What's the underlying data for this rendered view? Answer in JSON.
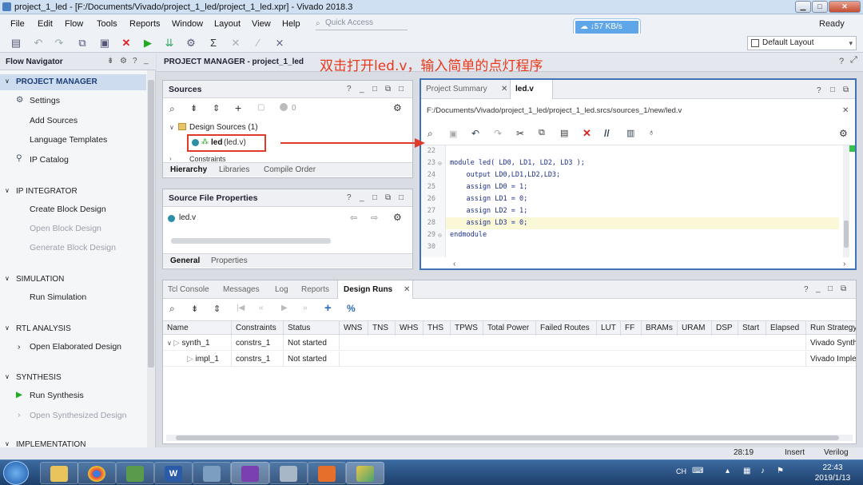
{
  "window": {
    "title": "project_1_led - [F:/Documents/Vivado/project_1_led/project_1_led.xpr] - Vivado 2018.3",
    "status": "Ready"
  },
  "menu": [
    "File",
    "Edit",
    "Flow",
    "Tools",
    "Reports",
    "Window",
    "Layout",
    "View",
    "Help"
  ],
  "quick_access": {
    "placeholder": "Quick Access"
  },
  "net_badge": "↓57 KB/s",
  "layout_select": "Default Layout",
  "flow_navigator": {
    "title": "Flow Navigator",
    "sections": [
      {
        "title": "PROJECT MANAGER",
        "items": [
          "Settings",
          "Add Sources",
          "Language Templates",
          "IP Catalog"
        ]
      },
      {
        "title": "IP INTEGRATOR",
        "items": [
          "Create Block Design",
          "Open Block Design",
          "Generate Block Design"
        ]
      },
      {
        "title": "SIMULATION",
        "items": [
          "Run Simulation"
        ]
      },
      {
        "title": "RTL ANALYSIS",
        "items": [
          "Open Elaborated Design"
        ]
      },
      {
        "title": "SYNTHESIS",
        "items": [
          "Run Synthesis",
          "Open Synthesized Design"
        ]
      },
      {
        "title": "IMPLEMENTATION",
        "items": []
      }
    ]
  },
  "project_manager": {
    "title": "PROJECT MANAGER - project_1_led"
  },
  "annotation": "双击打开led.v，输入简单的点灯程序",
  "sources": {
    "title": "Sources",
    "count_badge": "0",
    "design_sources": "Design Sources (1)",
    "file_name": "led",
    "file_paren": "(led.v)",
    "constraints": "Constraints",
    "tabs": [
      "Hierarchy",
      "Libraries",
      "Compile Order"
    ]
  },
  "source_props": {
    "title": "Source File Properties",
    "file": "led.v",
    "tabs": [
      "General",
      "Properties"
    ]
  },
  "editor": {
    "tabs": [
      "Project Summary",
      "led.v"
    ],
    "path": "F:/Documents/Vivado/project_1_led/project_1_led.srcs/sources_1/new/led.v",
    "lines": [
      {
        "n": "22",
        "text": ""
      },
      {
        "n": "23",
        "text": "module led( LD0, LD1, LD2, LD3 );"
      },
      {
        "n": "24",
        "text": "    output LD0,LD1,LD2,LD3;"
      },
      {
        "n": "25",
        "text": "    assign LD0 = 1;"
      },
      {
        "n": "26",
        "text": "    assign LD1 = 0;"
      },
      {
        "n": "27",
        "text": "    assign LD2 = 1;"
      },
      {
        "n": "28",
        "text": "    assign LD3 = 0;"
      },
      {
        "n": "29",
        "text": "endmodule"
      },
      {
        "n": "30",
        "text": ""
      }
    ]
  },
  "bottom": {
    "tabs": [
      "Tcl Console",
      "Messages",
      "Log",
      "Reports",
      "Design Runs"
    ],
    "columns": [
      "Name",
      "Constraints",
      "Status",
      "WNS",
      "TNS",
      "WHS",
      "THS",
      "TPWS",
      "Total Power",
      "Failed Routes",
      "LUT",
      "FF",
      "BRAMs",
      "URAM",
      "DSP",
      "Start",
      "Elapsed",
      "Run Strategy"
    ],
    "rows": [
      {
        "name": "synth_1",
        "constraints": "constrs_1",
        "status": "Not started",
        "strategy": "Vivado Synth"
      },
      {
        "name": "impl_1",
        "constraints": "constrs_1",
        "status": "Not started",
        "strategy": "Vivado Imple"
      }
    ]
  },
  "statusbar": {
    "position": "28:19",
    "mode": "Insert",
    "language": "Verilog"
  },
  "taskbar": {
    "lang": "CH",
    "time": "22:43",
    "date": "2019/1/13"
  },
  "colors": {
    "accent": "#2d6db5",
    "annotation": "#e8391d",
    "highlight_box": "#e03a2a"
  }
}
